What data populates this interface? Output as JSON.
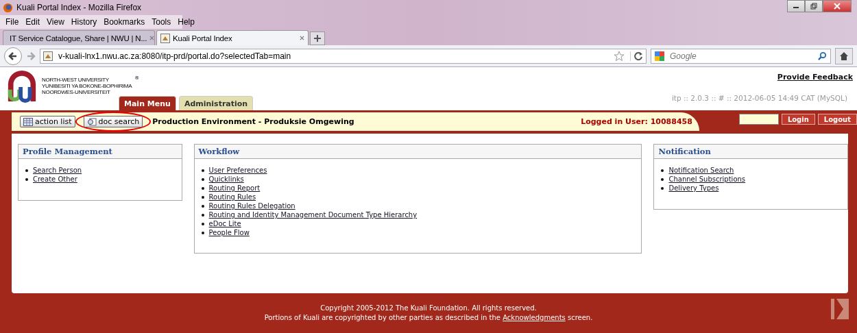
{
  "window": {
    "title": "Kuali Portal Index - Mozilla Firefox"
  },
  "menu": [
    "File",
    "Edit",
    "View",
    "History",
    "Bookmarks",
    "Tools",
    "Help"
  ],
  "browser_tabs": [
    {
      "label": "IT Service Catalogue, Share | NWU | N...",
      "selected": false
    },
    {
      "label": "Kuali Portal Index",
      "selected": true
    }
  ],
  "address_bar": {
    "value": "v-kuali-lnx1.nwu.ac.za:8080/itp-prd/portal.do?selectedTab=main"
  },
  "search": {
    "placeholder": "Google"
  },
  "header": {
    "logo_lines": [
      "NORTH-WEST UNIVERSITY",
      "YUNIBESITI YA BOKONE-BOPHIRIMA",
      "NOORDWES-UNIVERSITEIT"
    ],
    "registered_mark": "®",
    "feedback_link": "Provide Feedback",
    "version": "itp :: 2.0.3 :: # :: 2012-06-05 14:49 CAT (MySQL)"
  },
  "portal_tabs": [
    {
      "label": "Main Menu",
      "selected": true
    },
    {
      "label": "Administration",
      "selected": false
    }
  ],
  "toolbar": {
    "buttons": [
      {
        "label": "action list",
        "kind": "list",
        "highlighted": false
      },
      {
        "label": "doc search",
        "kind": "search",
        "highlighted": true
      }
    ],
    "environment": "Production Environment - Produksie Omgewing",
    "logged_in": "Logged in User: 10088458",
    "login": "Login",
    "logout": "Logout"
  },
  "panels": [
    {
      "title": "Profile Management",
      "links": [
        "Search Person",
        "Create Other"
      ]
    },
    {
      "title": "Workflow",
      "links": [
        "User Preferences",
        "Quicklinks",
        "Routing Report",
        "Routing Rules",
        "Routing Rules Delegation",
        "Routing and Identity Management Document Type Hierarchy",
        "eDoc Lite",
        "People Flow"
      ]
    },
    {
      "title": "Notification",
      "links": [
        "Notification Search",
        "Channel Subscriptions",
        "Delivery Types"
      ]
    }
  ],
  "footer": {
    "copyright": "Copyright 2005-2012 The Kuali Foundation. All rights reserved.",
    "portions": "Portions of Kuali are copyrighted by other parties as described in the ",
    "link": "Acknowledgments",
    "after": " screen."
  }
}
